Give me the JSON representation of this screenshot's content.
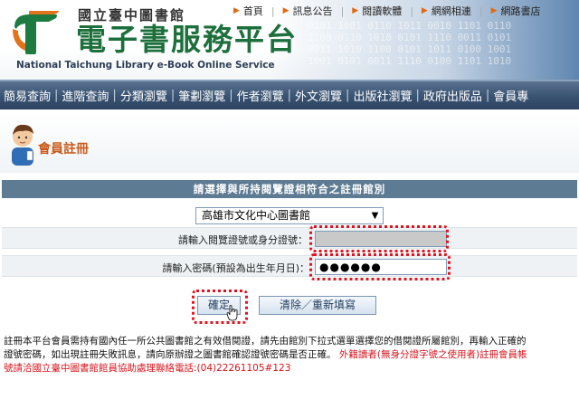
{
  "header": {
    "library_name": "國立臺中圖書館",
    "site_title": "電子書服務平台",
    "site_subtitle": "National Taichung Library  e-Book Online Service",
    "top_nav": [
      "首頁",
      "訊息公告",
      "閱讀軟體",
      "網網相連",
      "網路書店"
    ]
  },
  "menu": [
    "簡易查詢",
    "進階查詢",
    "分類瀏覽",
    "筆劃瀏覽",
    "作者瀏覽",
    "外文瀏覽",
    "出版社瀏覽",
    "政府出版品",
    "會員專"
  ],
  "page": {
    "title": "會員註冊"
  },
  "form": {
    "header": "請選擇與所持閱覽證相符合之註冊館別",
    "library_select": {
      "selected": "高雄市文化中心圖書館"
    },
    "id_label": "請輸入閱覽證號或身分證號：",
    "id_value": "",
    "password_label": "請輸入密碼(預設為出生年月日)：",
    "password_value": "●●●●●●",
    "ok_label": "確定",
    "reset_label": "清除／重新填寫"
  },
  "notes": {
    "line1": "註冊本平台會員需持有國內任一所公共圖書館之有效借閱證，請先由館別下拉式選單選擇您的借閱證所屬館別，再輸入正確的",
    "line2": "證號密碼，如出現註冊失敗訊息，請向原辦證之圖書館確認證號密碼是否正確。",
    "line2_red": "外籍讀者(無身分證字號之使用者)註冊會員帳",
    "line3_red": "號請洽國立臺中圖書館館員協助處理聯絡電話:(04)22261105#123"
  },
  "colors": {
    "title_green": "#1d6f3c",
    "menu_bar": "#3b5574",
    "page_title": "#c95a1a",
    "highlight_red": "#e0141e",
    "form_header": "#5e7b94"
  },
  "icons": {
    "logo": "library-t-logo-icon",
    "avatar": "member-avatar-icon",
    "cursor": "hand-cursor-icon"
  }
}
